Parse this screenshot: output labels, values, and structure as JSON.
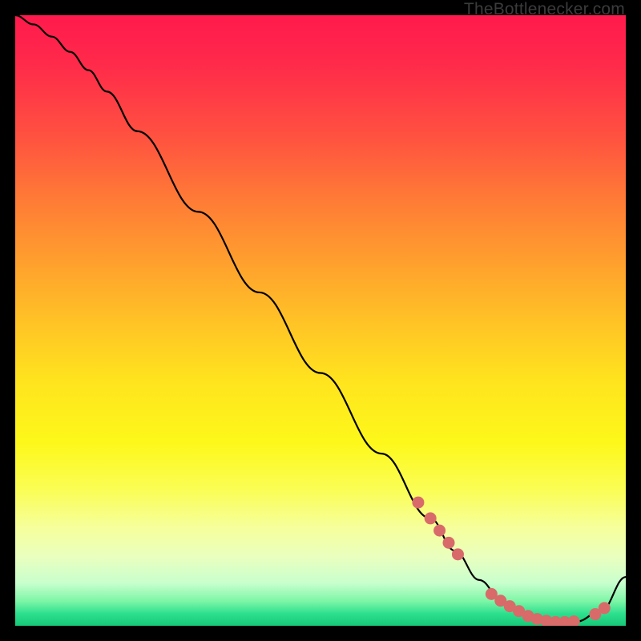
{
  "attribution": "TheBottlenecker.com",
  "chart_data": {
    "type": "line",
    "title": "",
    "xlabel": "",
    "ylabel": "",
    "xlim": [
      0,
      100
    ],
    "ylim": [
      0,
      100
    ],
    "series": [
      {
        "name": "curve",
        "x": [
          0,
          3,
          6,
          9,
          12,
          15,
          20,
          30,
          40,
          50,
          60,
          68,
          72,
          76,
          80,
          84,
          88,
          92,
          96,
          100
        ],
        "y": [
          100,
          98.5,
          96.5,
          94,
          91,
          87.5,
          81,
          67.8,
          54.6,
          41.4,
          28.2,
          17.6,
          12.3,
          7.5,
          3.8,
          1.6,
          0.6,
          0.7,
          2.5,
          8
        ]
      }
    ],
    "markers": [
      {
        "name": "cluster-descent",
        "x": [
          66,
          68,
          69.5,
          71,
          72.5
        ],
        "y": [
          20.2,
          17.6,
          15.6,
          13.6,
          11.7
        ]
      },
      {
        "name": "cluster-trough",
        "x": [
          78,
          79.5,
          81,
          82.5,
          84,
          85.5,
          87,
          88.5,
          90,
          91.5
        ],
        "y": [
          5.2,
          4.1,
          3.2,
          2.4,
          1.6,
          1.1,
          0.8,
          0.6,
          0.6,
          0.7
        ]
      },
      {
        "name": "cluster-rise",
        "x": [
          95,
          96.5
        ],
        "y": [
          1.9,
          2.9
        ]
      }
    ],
    "colors": {
      "curve": "#000000",
      "marker_fill": "#d96a6a",
      "marker_stroke": "#c44f4f"
    }
  }
}
